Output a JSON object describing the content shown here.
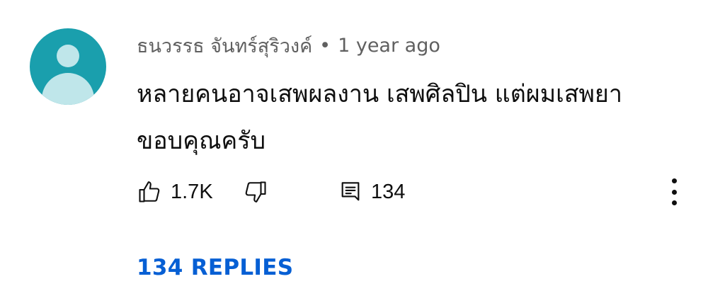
{
  "comment": {
    "author": "ธนวรรธ จันทร์สุริวงค์",
    "separator": "•",
    "timestamp": "1 year ago",
    "text_lines": [
      "หลายคนอาจเสพผลงาน เสพศิลปิน แต่ผมเสพยา",
      "ขอบคุณครับ"
    ],
    "avatar_icon": "default-user-avatar-icon",
    "colors": {
      "avatar_bg": "#1a9fad",
      "avatar_fg": "#bfe6ea",
      "link": "#065fd4",
      "meta_text": "#606060"
    }
  },
  "actions": {
    "like_icon": "thumbs-up-icon",
    "like_count": "1.7K",
    "dislike_icon": "thumbs-down-icon",
    "reply_icon": "comment-icon",
    "reply_count": "134",
    "more_icon": "more-vertical-icon"
  },
  "replies_link": "134 REPLIES"
}
